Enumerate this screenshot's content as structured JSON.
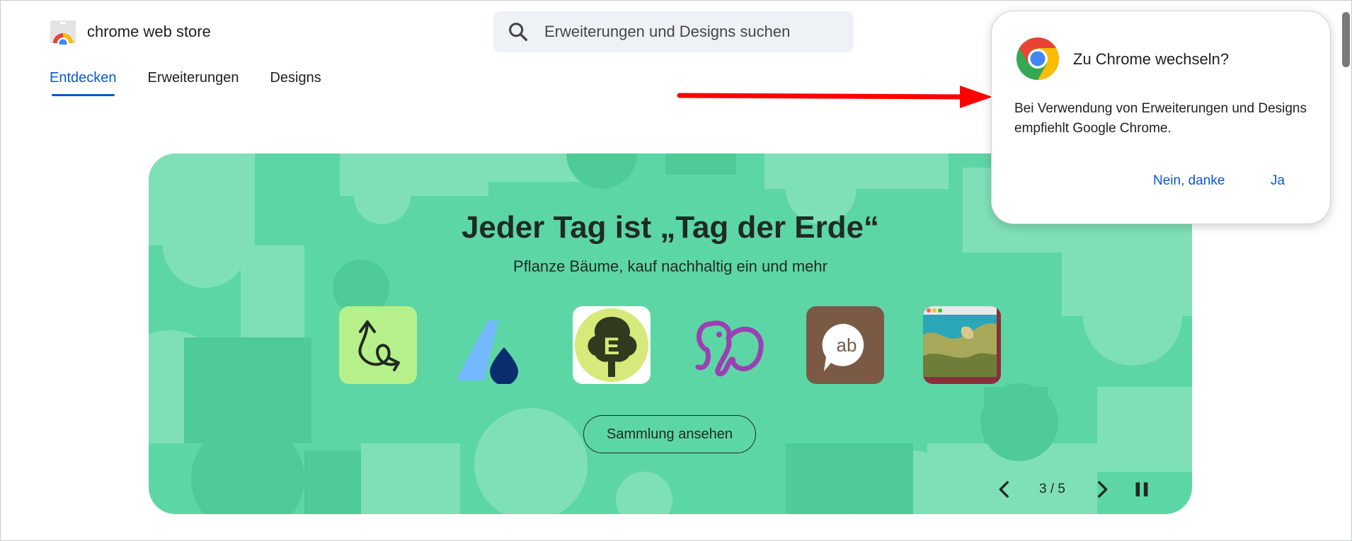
{
  "header": {
    "logo_text": "chrome web store",
    "search": {
      "placeholder": "Erweiterungen und Designs suchen",
      "value": ""
    }
  },
  "tabs": [
    {
      "label": "Entdecken",
      "active": true
    },
    {
      "label": "Erweiterungen",
      "active": false
    },
    {
      "label": "Designs",
      "active": false
    }
  ],
  "banner": {
    "title": "Jeder Tag ist „Tag der Erde“",
    "subtitle": "Pflanze Bäume, kauf nachhaltig ein und mehr",
    "button_label": "Sammlung ansehen",
    "background_color": "#5dd6a6",
    "tiles": [
      {
        "icon": "swirl-arrow-icon",
        "bg": "#b6f08a"
      },
      {
        "icon": "drop-logo-icon",
        "bg": "transparent"
      },
      {
        "icon": "tree-e-icon",
        "bg": "#ffffff"
      },
      {
        "icon": "elephant-icon",
        "bg": "transparent"
      },
      {
        "icon": "ab-bubble-icon",
        "bg": "#7a5a44"
      },
      {
        "icon": "landscape-map-icon",
        "bg": "#8b2f3a"
      }
    ],
    "carousel": {
      "counter": "3 / 5"
    }
  },
  "popup": {
    "title": "Zu Chrome wechseln?",
    "body": "Bei Verwendung von Erweiterungen und Designs empfiehlt Google Chrome.",
    "no_label": "Nein, danke",
    "yes_label": "Ja"
  },
  "colors": {
    "accent": "#0b57d0",
    "arrow": "#ff0000"
  }
}
